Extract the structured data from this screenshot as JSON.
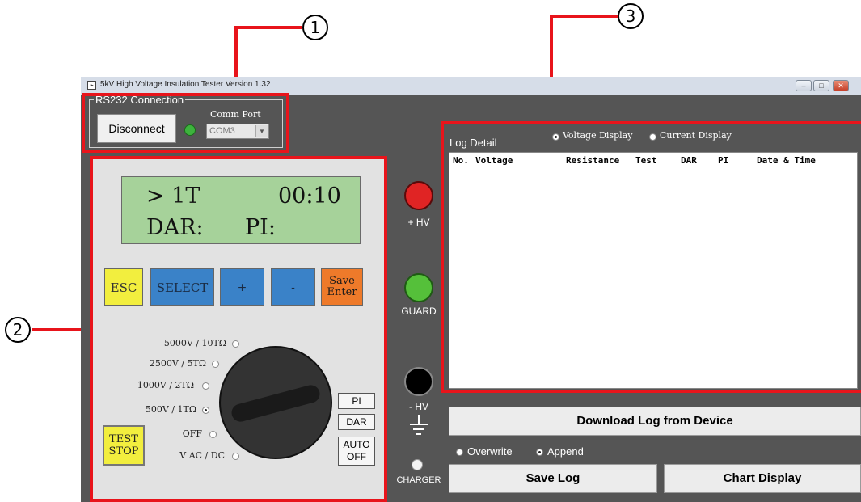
{
  "callouts": [
    "1",
    "2",
    "3"
  ],
  "window": {
    "title": "5kV High Voltage Insulation Tester  Version 1.32",
    "controls": {
      "minimize": "–",
      "maximize": "□",
      "close": "✕"
    }
  },
  "rs232": {
    "group_label": "RS232 Connection",
    "disconnect_label": "Disconnect",
    "status_color": "#3db33d",
    "comm_port_label": "Comm Port",
    "comm_port_value": "COM3"
  },
  "lcd": {
    "range": "> 1T",
    "time": "00:10",
    "dar_label": "DAR:",
    "pi_label": "PI:"
  },
  "keys": {
    "esc": "ESC",
    "select": "SELECT",
    "plus": "+",
    "minus": "-",
    "save_line1": "Save",
    "save_line2": "Enter"
  },
  "rotary": {
    "positions": [
      {
        "label": "5000V / 10TΩ",
        "selected": false
      },
      {
        "label": "2500V / 5TΩ",
        "selected": false
      },
      {
        "label": "1000V / 2TΩ",
        "selected": false
      },
      {
        "label": "500V / 1TΩ",
        "selected": true
      },
      {
        "label": "OFF",
        "selected": false
      },
      {
        "label": "V AC / DC",
        "selected": false
      }
    ]
  },
  "test_stop": {
    "line1": "TEST",
    "line2": "STOP"
  },
  "mode_buttons": {
    "pi": "PI",
    "dar": "DAR",
    "auto_line1": "AUTO",
    "auto_line2": "OFF"
  },
  "terminals": {
    "plus_hv": "+ HV",
    "guard": "GUARD",
    "minus_hv": "- HV",
    "charger": "CHARGER",
    "plus_hv_color": "#e02424",
    "guard_color": "#55c03a",
    "minus_hv_color": "#000000"
  },
  "log": {
    "title": "Log Detail",
    "display_options": [
      {
        "label": "Voltage Display",
        "selected": true
      },
      {
        "label": "Current Display",
        "selected": false
      }
    ],
    "columns": [
      "No.",
      "Voltage",
      "Resistance",
      "Test",
      "DAR",
      "PI",
      "Date & Time"
    ]
  },
  "actions": {
    "download": "Download Log from Device",
    "overwrite": "Overwrite",
    "append": "Append",
    "save_log": "Save Log",
    "chart_display": "Chart Display"
  },
  "colors": {
    "annotation_red": "#e8141b",
    "window_bg": "#555555",
    "lcd_bg": "#a6d29a",
    "key_yellow": "#f2ee3e",
    "key_blue": "#3a82c8",
    "key_orange": "#ee7a2a"
  }
}
